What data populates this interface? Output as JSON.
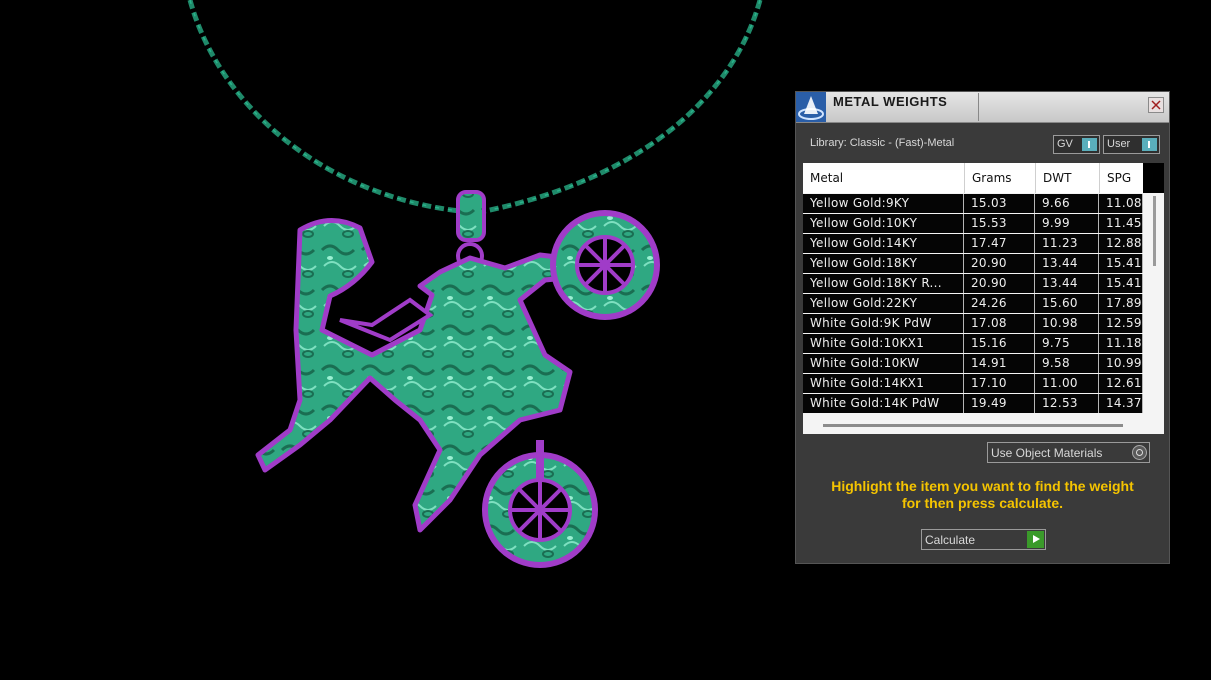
{
  "panel": {
    "title": "METAL WEIGHTS",
    "library_label": "Library: Classic - (Fast)-Metal",
    "toggles": [
      {
        "label": "GV"
      },
      {
        "label": "User"
      }
    ],
    "table": {
      "columns": [
        "Metal",
        "Grams",
        "DWT",
        "SPG"
      ],
      "rows": [
        {
          "metal": "Yellow Gold:9KY",
          "grams": "15.03",
          "dwt": "9.66",
          "spg": "11.08"
        },
        {
          "metal": "Yellow Gold:10KY",
          "grams": "15.53",
          "dwt": "9.99",
          "spg": "11.45"
        },
        {
          "metal": "Yellow Gold:14KY",
          "grams": "17.47",
          "dwt": "11.23",
          "spg": "12.88"
        },
        {
          "metal": "Yellow Gold:18KY",
          "grams": "20.90",
          "dwt": "13.44",
          "spg": "15.41"
        },
        {
          "metal": "Yellow Gold:18KY R...",
          "grams": "20.90",
          "dwt": "13.44",
          "spg": "15.41"
        },
        {
          "metal": "Yellow Gold:22KY",
          "grams": "24.26",
          "dwt": "15.60",
          "spg": "17.89"
        },
        {
          "metal": "White Gold:9K PdW",
          "grams": "17.08",
          "dwt": "10.98",
          "spg": "12.59"
        },
        {
          "metal": "White Gold:10KX1",
          "grams": "15.16",
          "dwt": "9.75",
          "spg": "11.18"
        },
        {
          "metal": "White Gold:10KW",
          "grams": "14.91",
          "dwt": "9.58",
          "spg": "10.99"
        },
        {
          "metal": "White Gold:14KX1",
          "grams": "17.10",
          "dwt": "11.00",
          "spg": "12.61"
        },
        {
          "metal": "White Gold:14K PdW",
          "grams": "19.49",
          "dwt": "12.53",
          "spg": "14.37"
        }
      ]
    },
    "use_object_materials": "Use Object Materials",
    "hint_line1": "Highlight the item you want to find the weight",
    "hint_line2": "for then press calculate.",
    "calculate_label": "Calculate"
  },
  "colors": {
    "pendant_fill": "#2fa882",
    "pendant_outline": "#a03cc8",
    "chain": "#1f8a6a",
    "hint_text": "#f5c400",
    "calculate_play": "#3a9a2a"
  },
  "icons": {
    "title_logo": "cone-logo-icon",
    "close": "close-icon",
    "calculate": "play-icon"
  }
}
